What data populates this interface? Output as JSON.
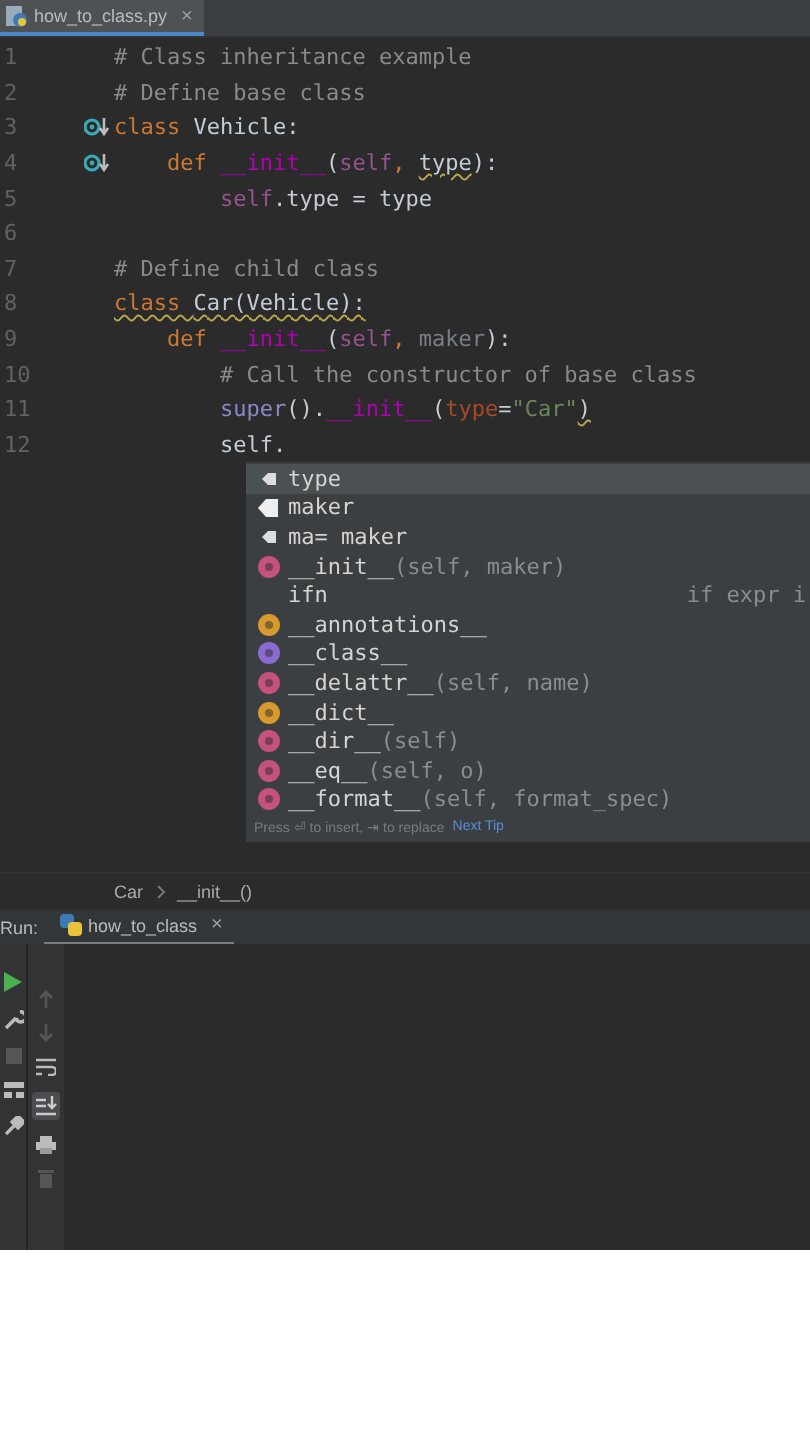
{
  "editor_tab": {
    "label": "how_to_class.py",
    "close": "×",
    "selected": true
  },
  "code_lines": [
    {
      "number": "1",
      "tokens": [
        {
          "kind": "comment",
          "text": "# Class inheritance example"
        }
      ]
    },
    {
      "number": "2",
      "tokens": [
        {
          "kind": "comment",
          "text": "# Define base class"
        }
      ]
    },
    {
      "number": "3",
      "mark": true,
      "tokens": [
        {
          "kind": "keyword",
          "text": "class "
        },
        {
          "kind": "plain",
          "text": "Vehicle:"
        }
      ]
    },
    {
      "number": "4",
      "mark": true,
      "tokens": [
        {
          "kind": "keyword",
          "text": "    def "
        },
        {
          "kind": "dunder",
          "text": "__init__"
        },
        {
          "kind": "plain",
          "text": "("
        },
        {
          "kind": "self",
          "text": "self"
        },
        {
          "kind": "keyword",
          "text": ", "
        },
        {
          "kind": "plain",
          "text": "type",
          "warning": true
        },
        {
          "kind": "plain",
          "text": "):"
        }
      ]
    },
    {
      "number": "5",
      "tokens": [
        {
          "kind": "self",
          "text": "        self"
        },
        {
          "kind": "plain",
          "text": ".type = type"
        }
      ]
    },
    {
      "number": "6"
    },
    {
      "number": "7",
      "tokens": [
        {
          "kind": "comment",
          "text": "# Define child class"
        }
      ]
    },
    {
      "number": "8",
      "tokens": [
        {
          "kind": "keyword",
          "text": "class ",
          "warning": true
        },
        {
          "kind": "plain",
          "text": "Car(Vehicle):",
          "warning": true
        }
      ]
    },
    {
      "number": "9",
      "tokens": [
        {
          "kind": "keyword",
          "text": "    def "
        },
        {
          "kind": "dunder",
          "text": "__init__"
        },
        {
          "kind": "plain",
          "text": "("
        },
        {
          "kind": "self",
          "text": "self"
        },
        {
          "kind": "keyword",
          "text": ", "
        },
        {
          "kind": "unused",
          "text": "maker"
        },
        {
          "kind": "plain",
          "text": "):"
        }
      ]
    },
    {
      "number": "10",
      "tokens": [
        {
          "kind": "comment",
          "text": "        # Call the constructor of base class"
        }
      ]
    },
    {
      "number": "11",
      "tokens": [
        {
          "kind": "builtin",
          "text": "        super"
        },
        {
          "kind": "plain",
          "text": "()."
        },
        {
          "kind": "dunder",
          "text": "__init__"
        },
        {
          "kind": "plain",
          "text": "("
        },
        {
          "kind": "param",
          "text": "type"
        },
        {
          "kind": "plain",
          "text": "="
        },
        {
          "kind": "string",
          "text": "\"Car\""
        },
        {
          "kind": "plain",
          "text": ")",
          "warning": true
        }
      ]
    },
    {
      "number": "12",
      "tokens": [
        {
          "kind": "plain",
          "text": "        self."
        }
      ]
    }
  ],
  "completion": {
    "items": [
      {
        "kind": "field",
        "name": "type",
        "selected": true
      },
      {
        "kind": "param",
        "name": "maker",
        "selected": false
      },
      {
        "kind": "field",
        "name": "ma= maker",
        "selected": false
      },
      {
        "kind": "method",
        "name": "__init__",
        "tail": "(self, maker)",
        "selected": false
      },
      {
        "kind": "template",
        "name": "ifn",
        "hint": "if expr i",
        "selected": false
      },
      {
        "kind": "function",
        "name": "__annotations__",
        "selected": false
      },
      {
        "kind": "property",
        "name": "__class__",
        "selected": false
      },
      {
        "kind": "method",
        "name": "__delattr__",
        "tail": "(self, name)",
        "selected": false
      },
      {
        "kind": "function",
        "name": "__dict__",
        "selected": false
      },
      {
        "kind": "method",
        "name": "__dir__",
        "tail": "(self)",
        "selected": false
      },
      {
        "kind": "method",
        "name": "__eq__",
        "tail": "(self, o)",
        "selected": false
      },
      {
        "kind": "method",
        "name": "__format__",
        "tail": "(self, format_spec)",
        "selected": false
      }
    ],
    "footer": "Press ⏎ to insert, ⇥ to replace",
    "tip_link": "Next Tip"
  },
  "breadcrumbs": [
    "Car",
    "__init__()"
  ],
  "run_panel": {
    "label": "Run:",
    "tab": {
      "label": "how_to_class",
      "close": "×",
      "selected": true
    }
  }
}
